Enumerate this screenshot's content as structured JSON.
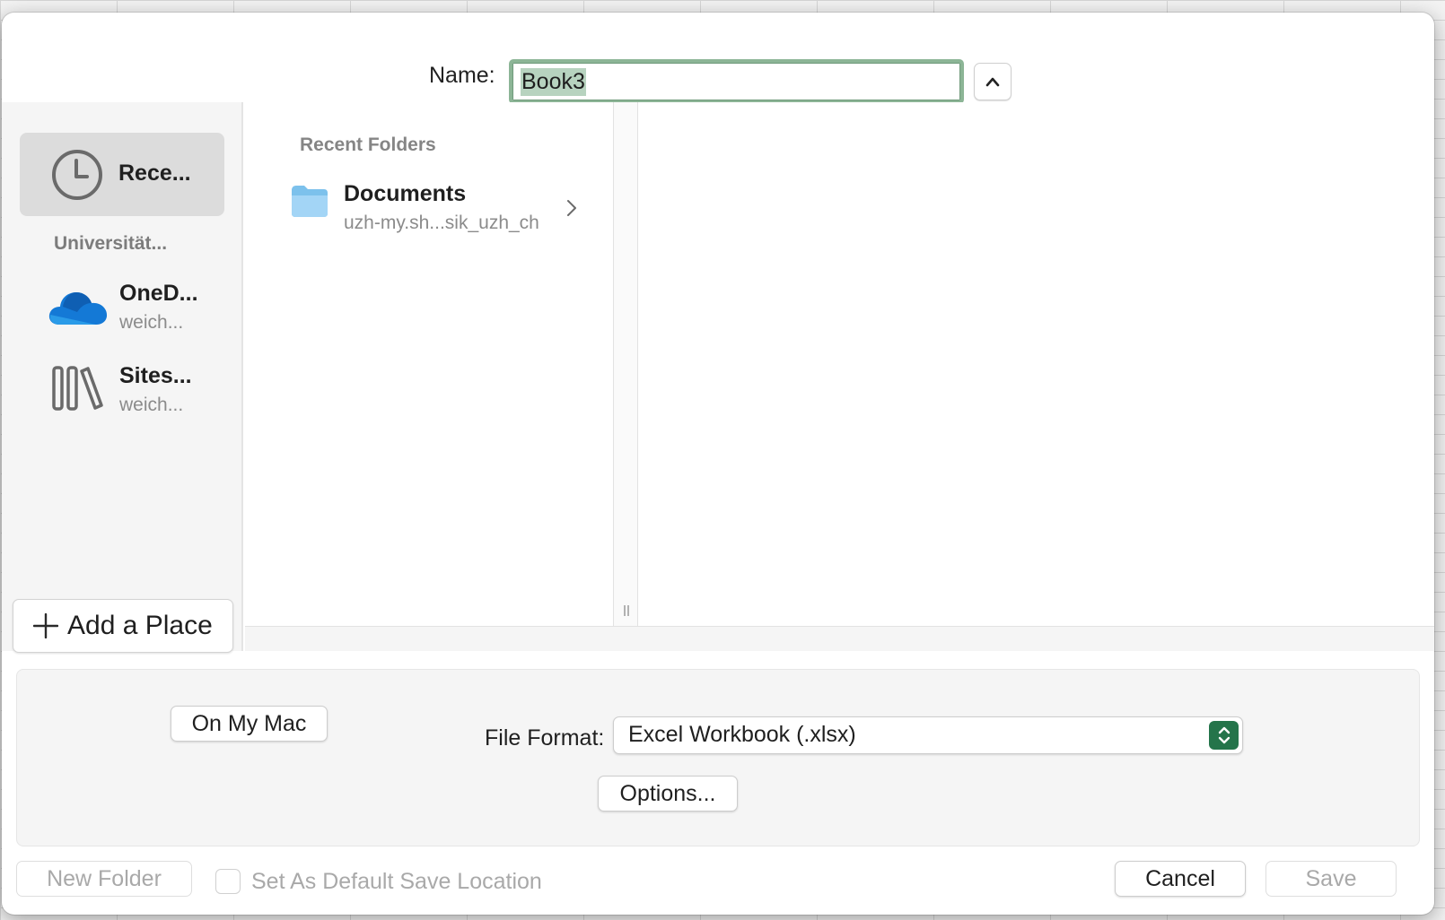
{
  "dialog": {
    "name_label": "Name:",
    "name_value": "Book3",
    "expand_icon": "chevron-up-icon"
  },
  "sidebar": {
    "recents": {
      "label": "Rece...",
      "icon": "clock-icon"
    },
    "section_label": "Universität...",
    "items": [
      {
        "label": "OneD...",
        "sublabel": "weich...",
        "icon": "onedrive-cloud-icon"
      },
      {
        "label": "Sites...",
        "sublabel": "weich...",
        "icon": "library-books-icon"
      }
    ],
    "add_place_label": "Add a Place"
  },
  "browser": {
    "column_header": "Recent Folders",
    "folders": [
      {
        "name": "Documents",
        "path": "uzh-my.sh...sik_uzh_ch"
      }
    ]
  },
  "options": {
    "on_my_mac_label": "On My Mac",
    "file_format_label": "File Format:",
    "file_format_value": "Excel Workbook (.xlsx)",
    "options_button_label": "Options..."
  },
  "footer": {
    "new_folder_label": "New Folder",
    "default_location_label": "Set As Default Save Location",
    "cancel_label": "Cancel",
    "save_label": "Save"
  },
  "colors": {
    "accent_green": "#24744a",
    "focus_ring": "#8cb596",
    "selection": "#b7d3bf"
  }
}
